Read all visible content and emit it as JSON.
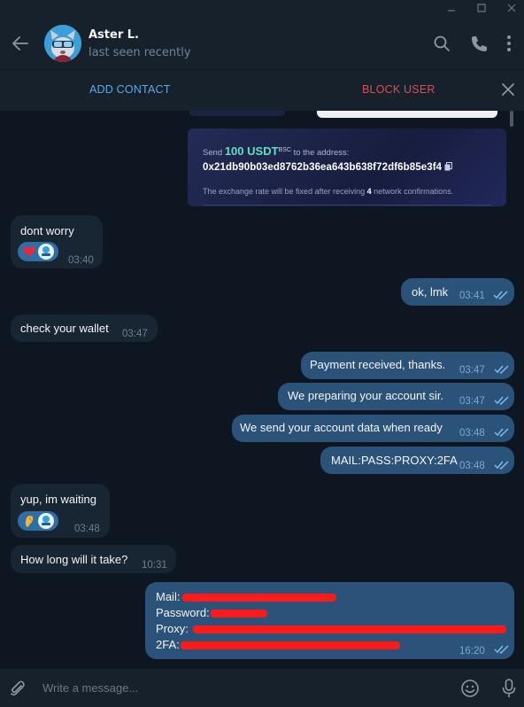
{
  "peer": {
    "name": "Aster L.",
    "status": "last seen recently"
  },
  "actions": {
    "add_contact": "ADD CONTACT",
    "block_user": "BLOCK USER"
  },
  "payment_screenshot": {
    "send_prefix": "Send",
    "amount": "100 USDT",
    "network": "BSC",
    "send_suffix": "to the address:",
    "address": "0x21db90b03ed8762b36ea643b638f72df6b85e3f4",
    "note_prefix": "The exchange rate will be fixed after receiving",
    "confirmations": "4",
    "note_suffix": "network confirmations."
  },
  "messages": [
    {
      "dir": "in",
      "text": "dont worry",
      "time": "03:40",
      "reaction": "heart"
    },
    {
      "dir": "out",
      "text": "ok, lmk",
      "time": "03:41"
    },
    {
      "dir": "in",
      "text": "check your wallet",
      "time": "03:47"
    },
    {
      "dir": "out",
      "text": "Payment received, thanks.",
      "time": "03:47"
    },
    {
      "dir": "out",
      "text": "We preparing your account sir.",
      "time": "03:47"
    },
    {
      "dir": "out",
      "text": "We send your account data when ready",
      "time": "03:48"
    },
    {
      "dir": "out",
      "text": "MAIL:PASS:PROXY:2FA",
      "time": "03:48"
    },
    {
      "dir": "in",
      "text": "yup, im waiting",
      "time": "03:48",
      "reaction": "ear"
    },
    {
      "dir": "in",
      "text": "How long will it take?",
      "time": "10:31"
    },
    {
      "dir": "out",
      "lines": [
        "Mail:",
        "Password:",
        "Proxy:",
        "2FA:"
      ],
      "time": "16:20"
    }
  ],
  "composer": {
    "placeholder": "Write a message..."
  },
  "colors": {
    "background": "#0e1621",
    "incoming_bubble": "#182533",
    "outgoing_bubble": "#2b5278",
    "accent": "#5fa8e6",
    "danger": "#e24b4b",
    "redaction": "#ff1a1a"
  }
}
